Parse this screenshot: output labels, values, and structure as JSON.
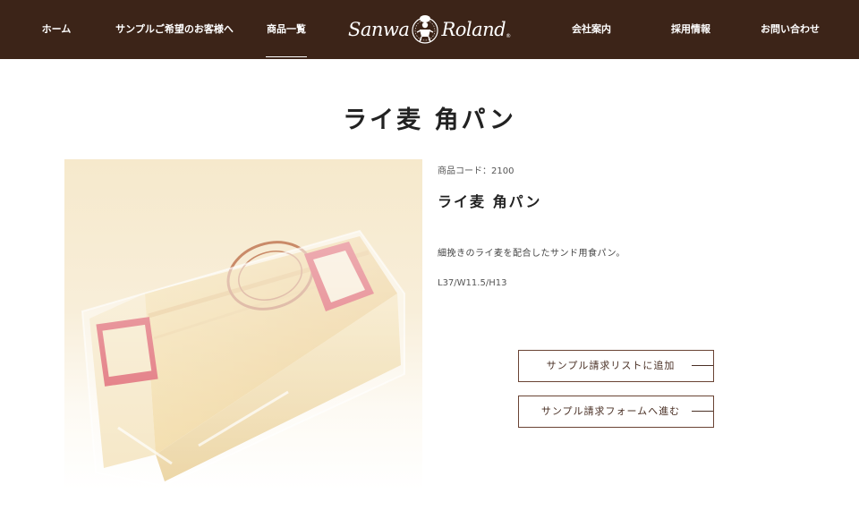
{
  "nav": {
    "items": [
      {
        "label": "ホーム"
      },
      {
        "label": "サンプルご希望のお客様へ"
      },
      {
        "label": "商品一覧",
        "active": true
      },
      {
        "label": "会社案内"
      },
      {
        "label": "採用情報"
      },
      {
        "label": "お問い合わせ"
      }
    ],
    "logo": {
      "left": "Sanwa",
      "right": "Roland",
      "mark": "®"
    }
  },
  "page": {
    "title": "ライ麦 角パン"
  },
  "product": {
    "code": "商品コード：2100",
    "name": "ライ麦 角パン",
    "description": "細挽きのライ麦を配合したサンド用食パン。",
    "size": "L37/W11.5/H13",
    "photo_icon": "bread-photo"
  },
  "actions": {
    "add_to_list": "サンプル請求リストに追加",
    "go_to_form": "サンプル請求フォームへ進む"
  },
  "colors": {
    "header_bg": "#3c2418",
    "button_border": "#6a4334",
    "accent": "#4a3025"
  }
}
